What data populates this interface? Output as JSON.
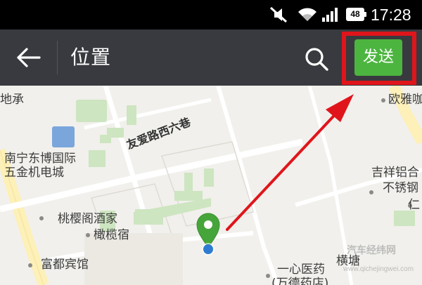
{
  "status_bar": {
    "time": "17:28",
    "battery": "48",
    "icons": [
      "mute-icon",
      "wifi-icon",
      "signal-icon",
      "battery-icon"
    ]
  },
  "toolbar": {
    "title": "位置",
    "send_label": "发送",
    "icons": [
      "back-arrow-icon",
      "search-icon"
    ],
    "colors": {
      "background": "#393a3f",
      "send": "#4cb53f",
      "highlight": "#e0151b"
    }
  },
  "map": {
    "street": "友爱路西六巷",
    "labels": {
      "left_edge": "地承",
      "east_shop": "欧雅咖",
      "expo_l1": "南宁东博国际",
      "expo_l2": "五金机电城",
      "metal_l1": "吉祥铝合",
      "metal_l2": "不锈钢",
      "hotel": "桃樱阁酒家",
      "inn": "橄榄宿",
      "fudu": "富都宾馆",
      "clinic_l1": "一心医药",
      "clinic_l2": "(万德药店)",
      "hengtang": "横塘",
      "ren": "仁"
    },
    "colors": {
      "land": "#f1f0ec",
      "green": "#cde5c0",
      "road": "#fdf3c4",
      "pin": "#46a53a",
      "dot": "#2e7bd1"
    }
  },
  "watermark": {
    "text": "汽车经纬网",
    "sub": "www.qichejingwei.com"
  }
}
